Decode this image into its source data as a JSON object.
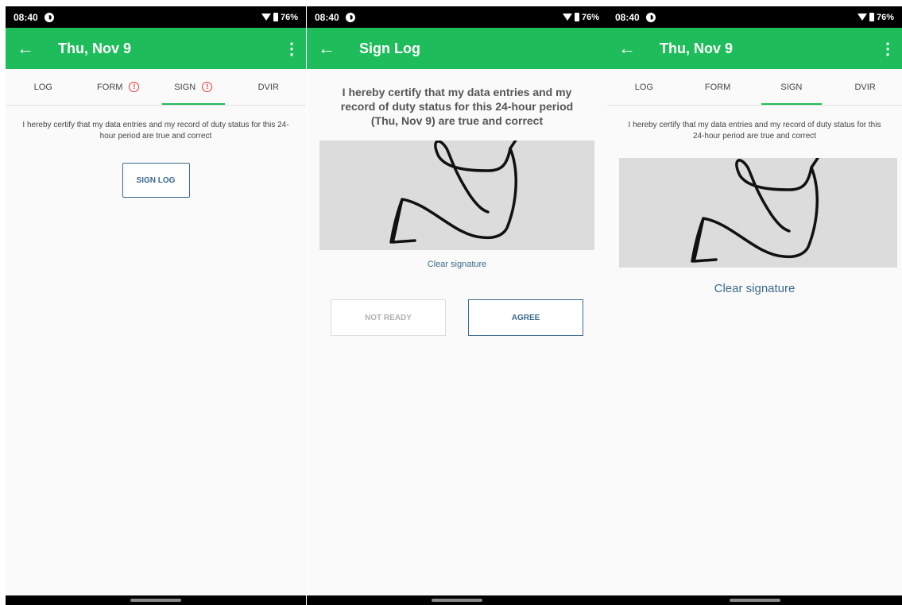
{
  "status_bar": {
    "time": "08:40",
    "battery": "76%"
  },
  "screen1": {
    "title": "Thu, Nov 9",
    "tabs": [
      {
        "label": "LOG"
      },
      {
        "label": "FORM"
      },
      {
        "label": "SIGN"
      },
      {
        "label": "DVIR"
      }
    ],
    "active_tab": "SIGN",
    "warning_tabs": [
      "FORM",
      "SIGN"
    ],
    "certification": "I hereby certify that my data entries and my record of duty status for this 24-hour period are true and correct",
    "sign_button": "SIGN LOG"
  },
  "screen2": {
    "title": "Sign Log",
    "certification": "I hereby certify that my data entries and my record of duty status for this 24-hour period (Thu, Nov 9) are true and correct",
    "clear_label": "Clear signature",
    "not_ready_label": "NOT READY",
    "agree_label": "AGREE"
  },
  "screen3": {
    "title": "Thu, Nov 9",
    "tabs": [
      {
        "label": "LOG"
      },
      {
        "label": "FORM"
      },
      {
        "label": "SIGN"
      },
      {
        "label": "DVIR"
      }
    ],
    "active_tab": "SIGN",
    "certification": "I hereby certify that my data entries and my record of duty status for this 24-hour period are true and correct",
    "clear_label": "Clear signature"
  },
  "colors": {
    "app_bar": "#1ebc5a",
    "status_bar": "#000000",
    "accent_blue": "#3b6a8c",
    "warning_red": "#e53935",
    "signature_pad": "#dcdcdc"
  }
}
